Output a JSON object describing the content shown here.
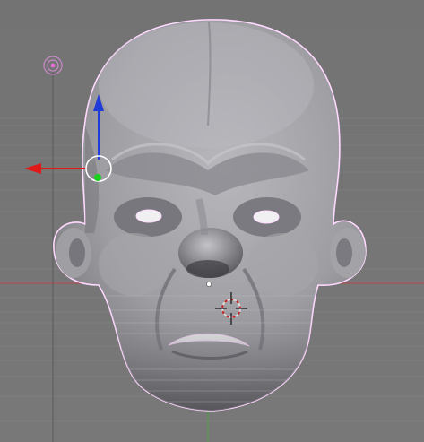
{
  "app": {
    "name": "3D Viewport",
    "mode": "sculpt"
  },
  "viewport": {
    "background": "#767676",
    "grid_color": "#8a8a8a",
    "axis_x_color": "#b54a4a",
    "axis_y_color": "#4aa34a"
  },
  "object": {
    "name_icon": "head-mesh",
    "body_color": "#a9a9ad",
    "outline_color": "#ffd9ff"
  },
  "gizmo": {
    "x_axis_color": "#e01818",
    "z_axis_color": "#1f3bd8",
    "center_color": "#18d21f",
    "handle_color": "#ffffff"
  },
  "lamp": {
    "icon": "lamp-icon",
    "color": "#c98ac9"
  },
  "cursor": {
    "icon": "3d-cursor-icon"
  }
}
